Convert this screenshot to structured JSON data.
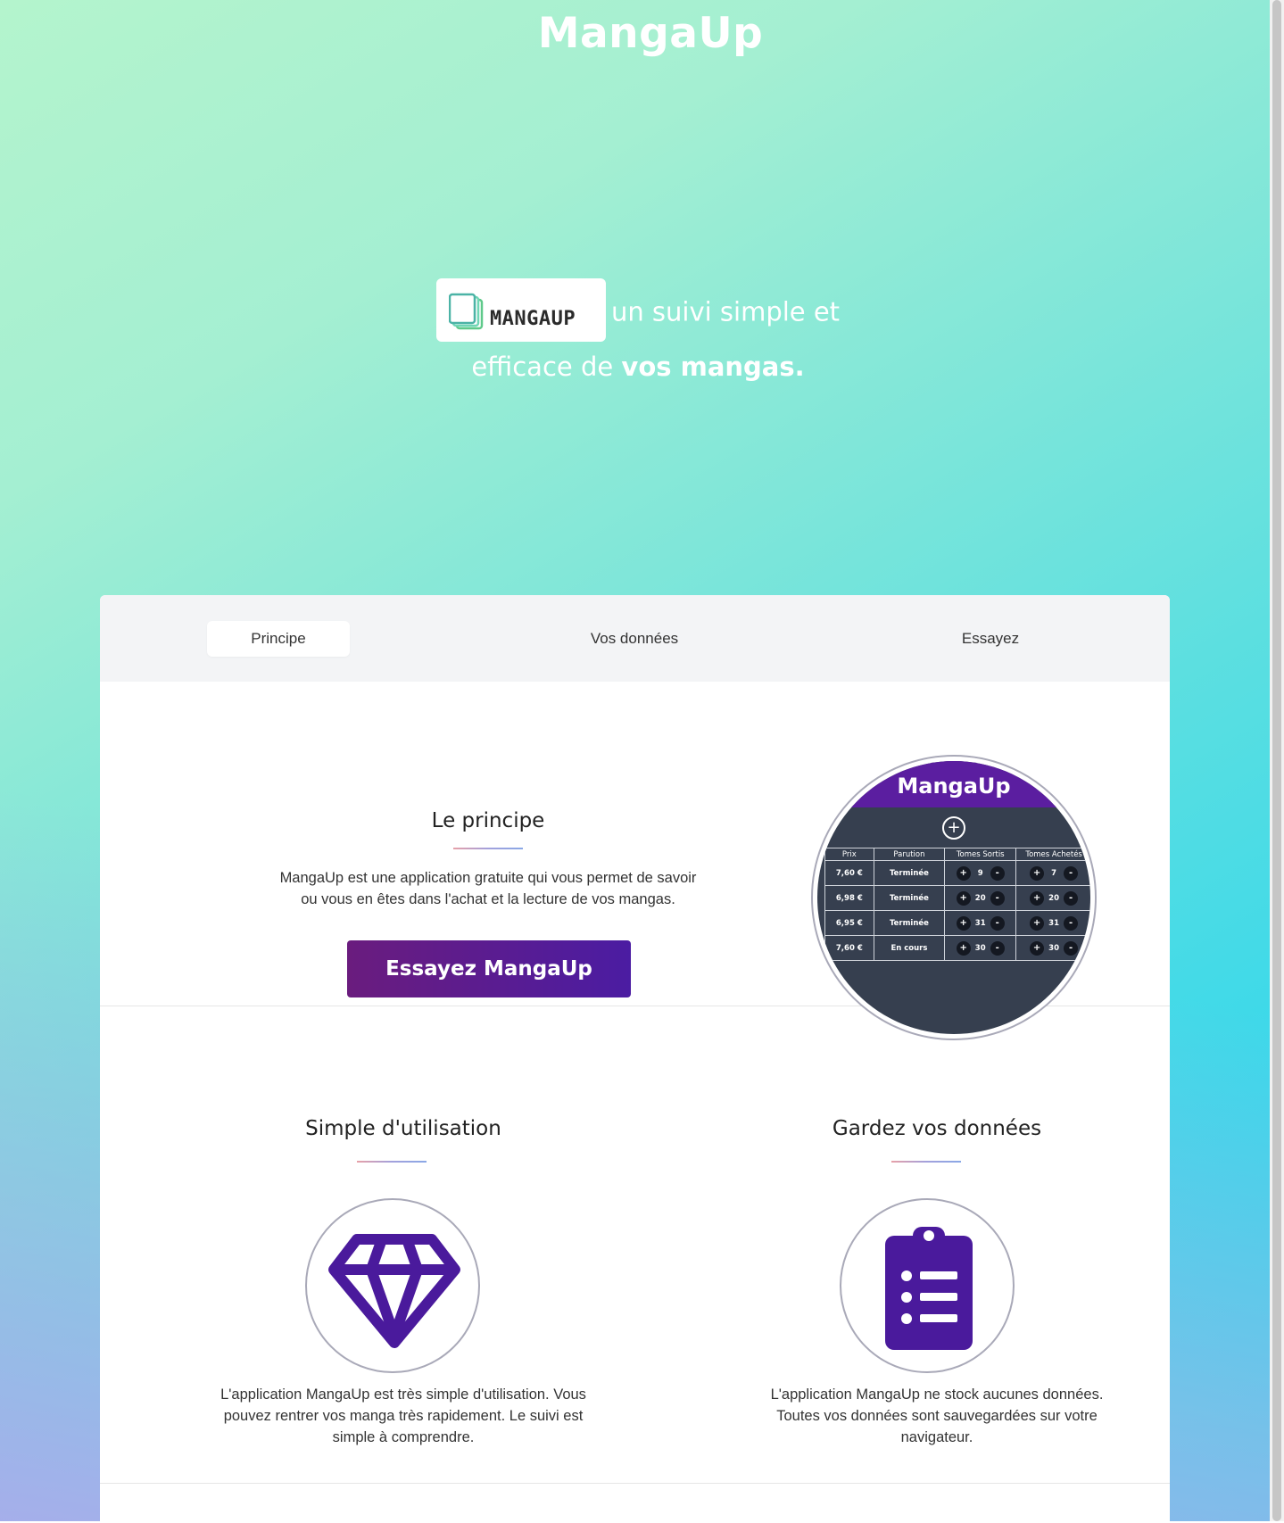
{
  "header": {
    "title": "MangaUp"
  },
  "hero": {
    "logo_text": "MANGAUP",
    "tagline_part1": "un suivi simple et",
    "tagline_part2": "efficace de",
    "tagline_bold": "vos mangas."
  },
  "tabs": [
    {
      "label": "Principe",
      "active": true
    },
    {
      "label": "Vos données",
      "active": false
    },
    {
      "label": "Essayez",
      "active": false
    }
  ],
  "principe": {
    "title": "Le principe",
    "text_line1": "MangaUp est une application gratuite qui vous permet de savoir",
    "text_line2": "ou vous en êtes dans l'achat et la lecture de vos mangas.",
    "cta_label": "Essayez MangaUp"
  },
  "preview": {
    "brand": "MangaUp",
    "plus": "+",
    "headers": [
      "Prix",
      "Parution",
      "Tomes Sortis",
      "Tomes Achetés"
    ],
    "rows": [
      {
        "prix": "7,60 €",
        "parution": "Terminée",
        "sortis": "9",
        "achetes": "7"
      },
      {
        "prix": "6,98 €",
        "parution": "Terminée",
        "sortis": "20",
        "achetes": "20"
      },
      {
        "prix": "6,95 €",
        "parution": "Terminée",
        "sortis": "31",
        "achetes": "31"
      },
      {
        "prix": "7,60 €",
        "parution": "En cours",
        "sortis": "30",
        "achetes": "30"
      }
    ],
    "plus_btn": "+",
    "minus_btn": "-"
  },
  "features": {
    "simple": {
      "title": "Simple d'utilisation",
      "line1": "L'application MangaUp est très simple d'utilisation. Vous",
      "line2": "pouvez rentrer vos manga très rapidement. Le suivi est",
      "line3": "simple à comprendre.",
      "icon": "diamond-icon"
    },
    "donnees": {
      "title": "Gardez vos données",
      "line1": "L'application MangaUp ne stock aucunes données.",
      "line2": "Toutes vos données sont sauvegardées sur votre",
      "line3": "navigateur.",
      "icon": "clipboard-list-icon"
    }
  },
  "colors": {
    "accent_purple": "#4b1ca2",
    "icon_purple": "#4a1a9c"
  }
}
